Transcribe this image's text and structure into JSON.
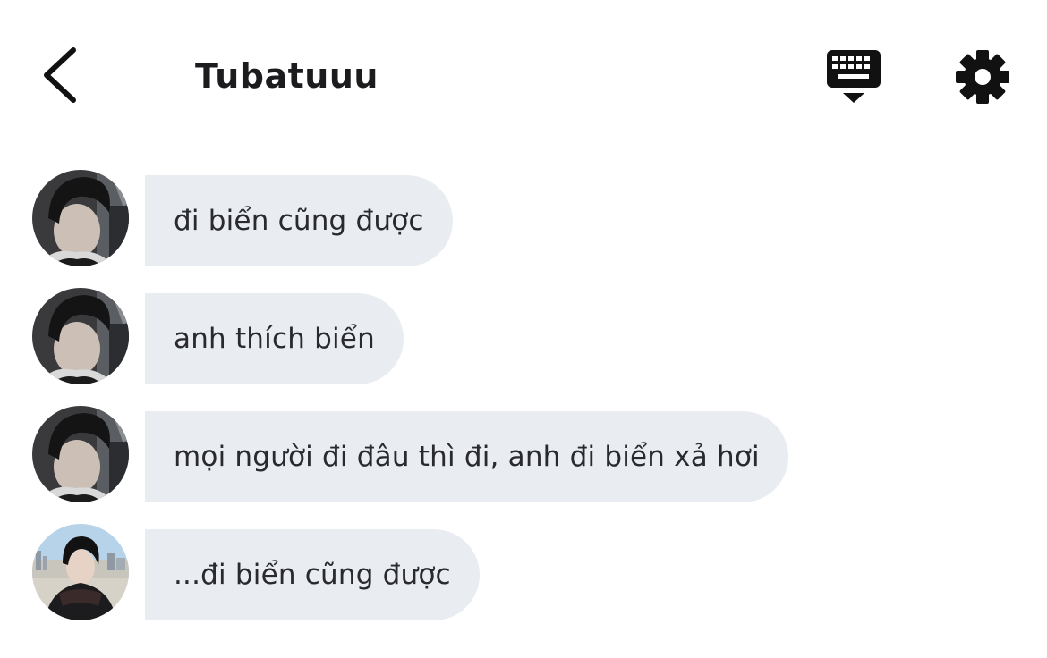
{
  "header": {
    "back_icon": "chevron-left-icon",
    "title": "Tubatuuu",
    "keyboard_icon": "keyboard-hide-icon",
    "settings_icon": "gear-icon"
  },
  "messages": [
    {
      "sender": "other",
      "avatar": "avatar-dark-hair",
      "text": "đi biển cũng được"
    },
    {
      "sender": "other",
      "avatar": "avatar-dark-hair",
      "text": "anh thích biển"
    },
    {
      "sender": "other",
      "avatar": "avatar-dark-hair",
      "text": "mọi người đi đâu thì đi, anh đi biển xả hơi"
    },
    {
      "sender": "self",
      "avatar": "avatar-beach-scarf",
      "text": "...đi biển cũng được"
    }
  ],
  "colors": {
    "bubble": "#e9edf1",
    "text": "#2a2a2e",
    "icon": "#111111",
    "background": "#ffffff"
  }
}
